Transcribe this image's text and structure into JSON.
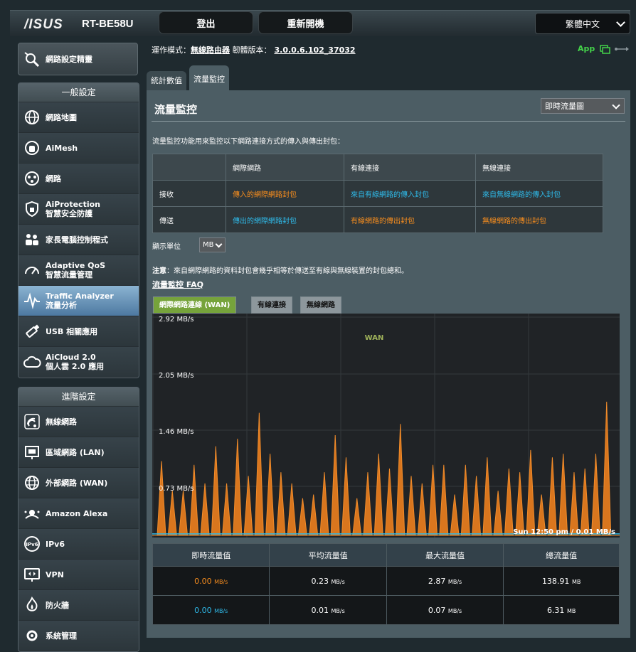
{
  "header": {
    "logo": "/ISUS",
    "model": "RT-BE58U",
    "logout": "登出",
    "reboot": "重新開機",
    "language": "繁體中文"
  },
  "status": {
    "op_mode_label": "運作模式：",
    "op_mode": "無線路由器",
    "fw_label": "韌體版本：",
    "fw": "3.0.0.6.102_37032",
    "app": "App"
  },
  "sidebar": {
    "quick": "網路設定精靈",
    "general_title": "一般設定",
    "general": [
      {
        "line1": "網路地圖",
        "line2": "",
        "icon": "globe-icon"
      },
      {
        "line1": "AiMesh",
        "line2": "",
        "icon": "aimesh-icon"
      },
      {
        "line1": "網路",
        "line2": "",
        "icon": "network-icon"
      },
      {
        "line1": "AiProtection",
        "line2": "智慧安全防護",
        "icon": "shield-icon"
      },
      {
        "line1": "家長電腦控制程式",
        "line2": "",
        "icon": "family-icon"
      },
      {
        "line1": "Adaptive QoS",
        "line2": "智慧流量管理",
        "icon": "gauge-icon"
      },
      {
        "line1": "Traffic Analyzer",
        "line2": "流量分析",
        "icon": "pulse-icon"
      },
      {
        "line1": "USB 相關應用",
        "line2": "",
        "icon": "usb-icon"
      },
      {
        "line1": "AiCloud 2.0",
        "line2": "個人雲 2.0 應用",
        "icon": "cloud-icon"
      }
    ],
    "advanced_title": "進階設定",
    "advanced": [
      {
        "line1": "無線網路",
        "line2": "",
        "icon": "wifi-icon"
      },
      {
        "line1": "區域網路 (LAN)",
        "line2": "",
        "icon": "lan-icon"
      },
      {
        "line1": "外部網路 (WAN)",
        "line2": "",
        "icon": "wan-icon"
      },
      {
        "line1": "Amazon Alexa",
        "line2": "",
        "icon": "alexa-icon"
      },
      {
        "line1": "IPv6",
        "line2": "",
        "icon": "ipv6-icon"
      },
      {
        "line1": "VPN",
        "line2": "",
        "icon": "vpn-icon"
      },
      {
        "line1": "防火牆",
        "line2": "",
        "icon": "firewall-icon"
      },
      {
        "line1": "系統管理",
        "line2": "",
        "icon": "gear-icon"
      }
    ]
  },
  "tabs": [
    "統計數值",
    "流量監控"
  ],
  "page": {
    "title": "流量監控",
    "mode_select": "即時流量圖",
    "description": "流量監控功能用來監控以下網路連接方式的傳入與傳出封包：",
    "table": {
      "headers": [
        "",
        "網際網路",
        "有線連接",
        "無線連接"
      ],
      "rows": [
        [
          "接收",
          "傳入的網際網路封包",
          "來自有線網路的傳入封包",
          "來自無線網路的傳入封包"
        ],
        [
          "傳送",
          "傳出的網際網路封包",
          "有線網路的傳出封包",
          "無線網路的傳出封包"
        ]
      ]
    },
    "unit_label": "顯示單位",
    "unit": "MB",
    "note_bold": "注意",
    "note": "：來自網際網路的資料封包會幾乎相等於傳送至有線與無線裝置的封包總和。",
    "faq": "流量監控 FAQ",
    "graph_tabs": [
      "網際網路連線 (WAN)",
      "有線連接",
      "無線網路"
    ]
  },
  "chart_data": {
    "type": "area",
    "series_label": "WAN",
    "y_ticks": [
      "2.92 MB/s",
      "2.05 MB/s",
      "1.46 MB/s",
      "0.73 MB/s"
    ],
    "time_label": "Sun 12:50 pm / 0.01 MB/s",
    "ylim": [
      0,
      2.92
    ],
    "orange_peaks": [
      1.0,
      0.6,
      0.6,
      0.95,
      0.7,
      1.2,
      0.7,
      1.3,
      0.8,
      1.65,
      1.1,
      0.85,
      0.7,
      0.5,
      0.55,
      0.85,
      1.35,
      1.05,
      0.5,
      0.85,
      1.1,
      0.9,
      1.5,
      0.8,
      0.7,
      0.95,
      0.95,
      0.55,
      0.95,
      0.8,
      1.05,
      0.6,
      0.9,
      0.85,
      1.15,
      0.55,
      1.05,
      1.1,
      0.85,
      0.9,
      1.1,
      1.8
    ],
    "blue_level": 0.02
  },
  "stats": {
    "headers": [
      "即時流量值",
      "平均流量值",
      "最大流量值",
      "總流量值"
    ],
    "rows": [
      {
        "values": [
          "0.00",
          "0.23",
          "2.87",
          "138.91"
        ],
        "units": [
          "MB/s",
          "MB/s",
          "MB/s",
          "MB"
        ],
        "color": "#f78d1e"
      },
      {
        "values": [
          "0.00",
          "0.01",
          "0.07",
          "6.31"
        ],
        "units": [
          "MB/s",
          "MB/s",
          "MB/s",
          "MB"
        ],
        "color": "#2fb9e8"
      }
    ]
  }
}
